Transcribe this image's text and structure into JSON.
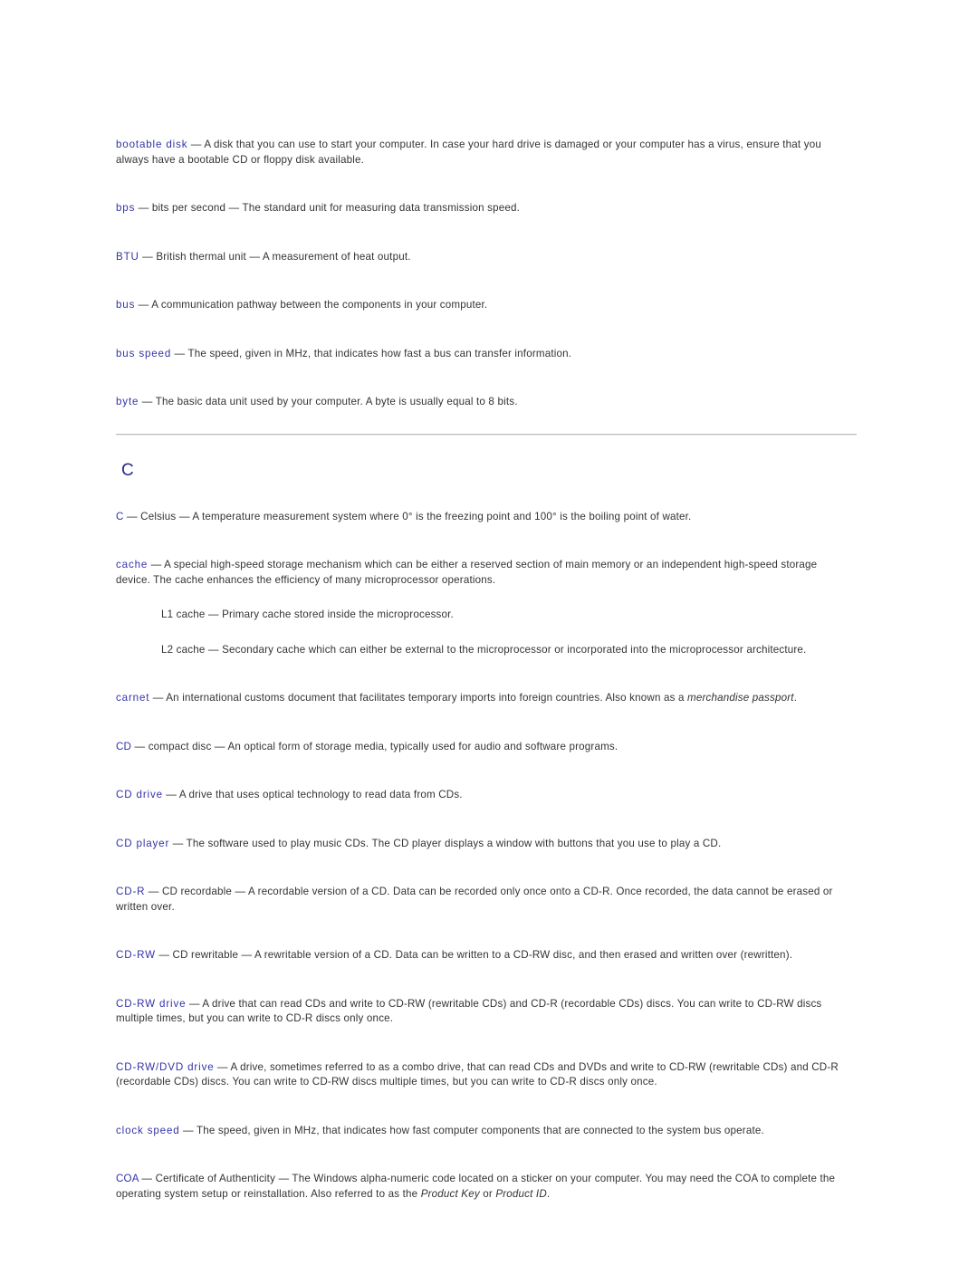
{
  "document": {
    "type": "glossary",
    "colors": {
      "term": "#3333AA",
      "body": "#333333",
      "heading": "#2A2A8C",
      "rule": "#BDBDBD",
      "background": "#FFFFFF"
    }
  },
  "section_b_entries": [
    {
      "term": "bootable disk",
      "dash": " — ",
      "definition": "A disk that you can use to start your computer. In case your hard drive is damaged or your computer has a virus, ensure that you always have a bootable CD or floppy disk available."
    },
    {
      "term": "bps",
      "dash": " — ",
      "definition": "bits per second — The standard unit for measuring data transmission speed."
    },
    {
      "term": "BTU",
      "dash": " — ",
      "definition": "British thermal unit — A measurement of heat output."
    },
    {
      "term": "bus",
      "dash": " — ",
      "definition": "A communication pathway between the components in your computer."
    },
    {
      "term": "bus speed",
      "dash": " — ",
      "definition": "The speed, given in MHz, that indicates how fast a bus can transfer information."
    },
    {
      "term": "byte",
      "dash": " — ",
      "definition": "The basic data unit used by your computer. A byte is usually equal to 8 bits."
    }
  ],
  "section_c": {
    "letter": "C",
    "entries": {
      "celsius": {
        "term": "C",
        "dash": " — ",
        "definition": "Celsius — A temperature measurement system where 0° is the freezing point and 100° is the boiling point of water."
      },
      "cache": {
        "term": "cache",
        "dash": " — ",
        "definition": "A special high-speed storage mechanism which can be either a reserved section of main memory or an independent high-speed storage device. The cache enhances the efficiency of many microprocessor operations.",
        "sub_entries": [
          "L1 cache — Primary cache stored inside the microprocessor.",
          "L2 cache — Secondary cache which can either be external to the microprocessor or incorporated into the microprocessor architecture."
        ]
      },
      "carnet": {
        "term": "carnet",
        "dash": " — ",
        "definition_before": "An international customs document that facilitates temporary imports into foreign countries. Also known as a ",
        "italic": "merchandise passport",
        "definition_after": "."
      },
      "cd": {
        "term": "CD",
        "dash": " — ",
        "definition": "compact disc — An optical form of storage media, typically used for audio and software programs."
      },
      "cd_drive": {
        "term": "CD drive",
        "dash": " — ",
        "definition": "A drive that uses optical technology to read data from CDs."
      },
      "cd_player": {
        "term": "CD player",
        "dash": " — ",
        "definition": "The software used to play music CDs. The CD player displays a window with buttons that you use to play a CD."
      },
      "cd_r": {
        "term": "CD-R",
        "dash": " — ",
        "definition": "CD recordable — A recordable version of a CD. Data can be recorded only once onto a CD-R. Once recorded, the data cannot be erased or written over."
      },
      "cd_rw": {
        "term": "CD-RW",
        "dash": " — ",
        "definition": "CD rewritable — A rewritable version of a CD. Data can be written to a CD-RW disc, and then erased and written over (rewritten)."
      },
      "cd_rw_drive": {
        "term": "CD-RW drive",
        "dash": " — ",
        "definition": "A drive that can read CDs and write to CD-RW (rewritable CDs) and CD-R (recordable CDs) discs. You can write to CD-RW discs multiple times, but you can write to CD-R discs only once."
      },
      "cd_rw_dvd_drive": {
        "term": "CD-RW/DVD drive",
        "dash": " — ",
        "definition": "A drive, sometimes referred to as a combo drive, that can read CDs and DVDs and write to CD-RW (rewritable CDs) and CD-R (recordable CDs) discs. You can write to CD-RW discs multiple times, but you can write to CD-R discs only once."
      },
      "clock_speed": {
        "term": "clock speed",
        "dash": " — ",
        "definition": "The speed, given in MHz, that indicates how fast computer components that are connected to the system bus operate."
      },
      "coa": {
        "term": "COA",
        "dash": " — ",
        "definition_before": "Certificate of Authenticity — The Windows alpha-numeric code located on a sticker on your computer. You may need the COA to complete the operating system setup or reinstallation. Also referred to as the ",
        "italic_1": "Product Key",
        "definition_middle": " or ",
        "italic_2": "Product ID",
        "definition_after": "."
      }
    }
  }
}
